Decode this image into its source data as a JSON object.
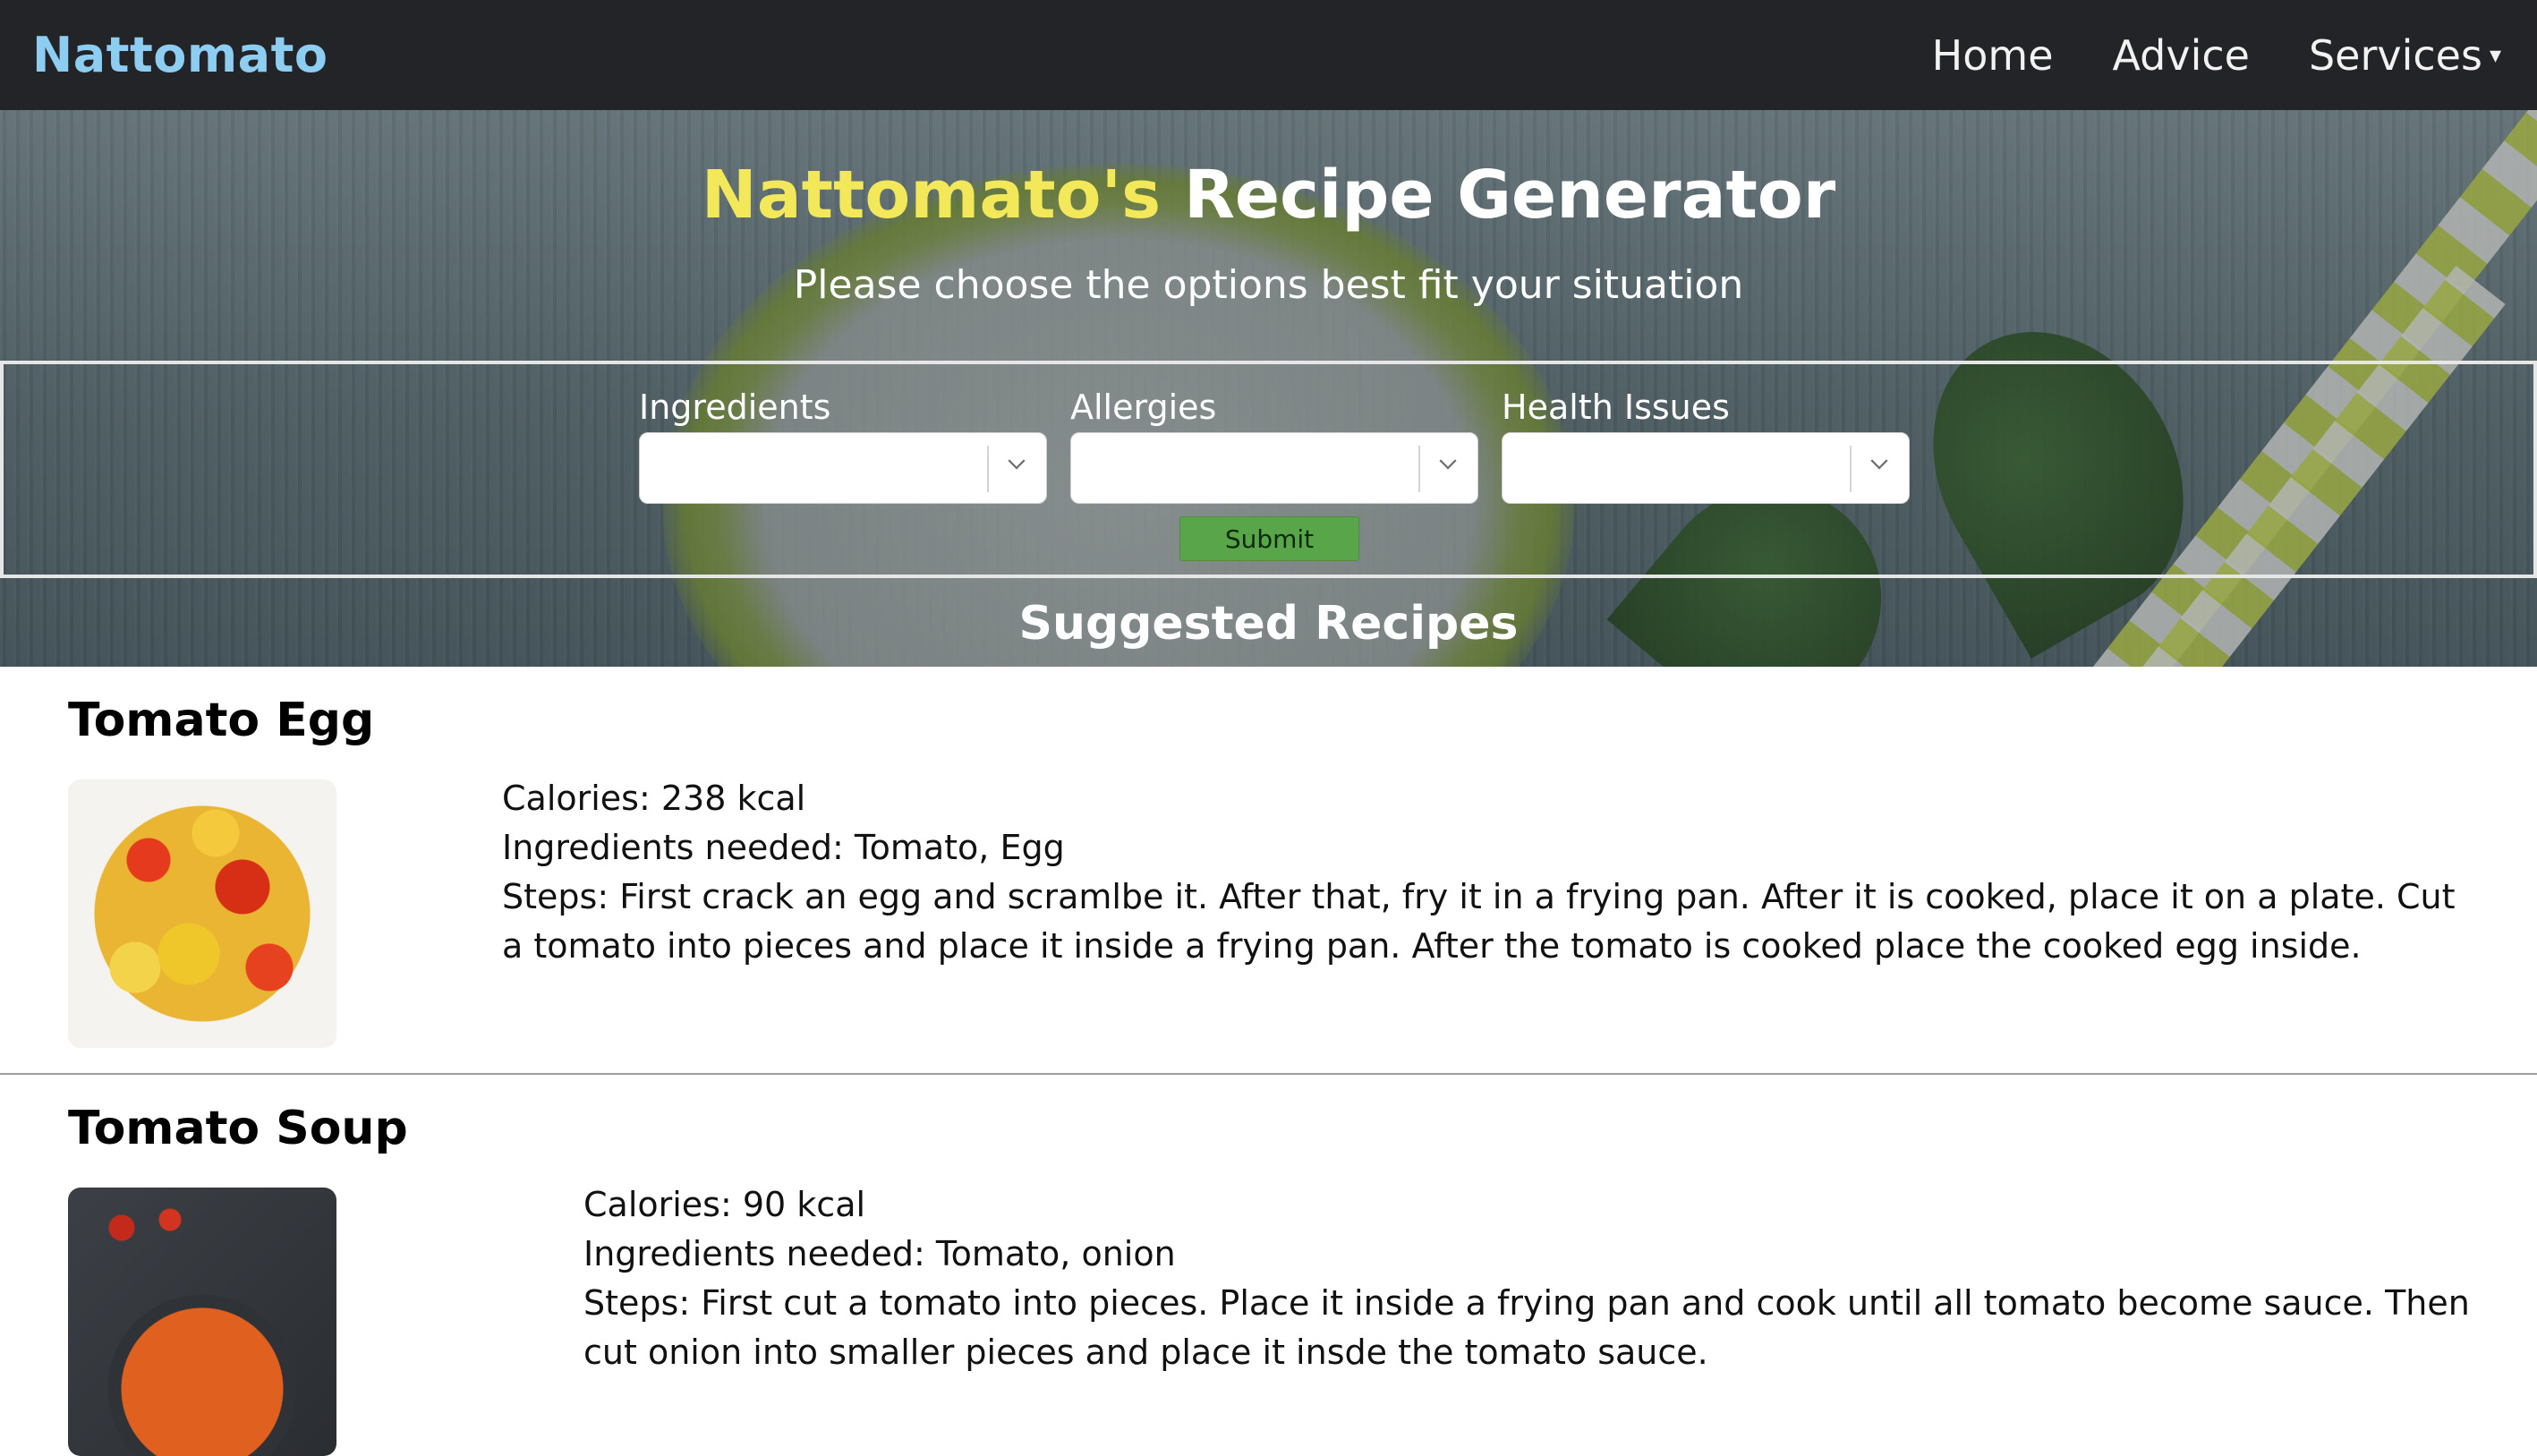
{
  "navbar": {
    "brand": "Nattomato",
    "links": [
      {
        "label": "Home"
      },
      {
        "label": "Advice"
      },
      {
        "label": "Services"
      }
    ],
    "services_caret": "▾"
  },
  "hero": {
    "title_accent": "Nattomato's",
    "title_rest": " Recipe Generator",
    "subtitle": "Please choose the options best fit your situation",
    "filters": [
      {
        "label": "Ingredients",
        "value": ""
      },
      {
        "label": "Allergies",
        "value": ""
      },
      {
        "label": "Health Issues",
        "value": ""
      }
    ],
    "submit_label": "Submit",
    "suggested_title": "Suggested Recipes"
  },
  "recipes": [
    {
      "title": "Tomato Egg",
      "calories": "Calories: 238 kcal",
      "ingredients": "Ingredients needed: Tomato, Egg",
      "steps": "Steps: First crack an egg and scramlbe it. After that, fry it in a frying pan. After it is cooked, place it on a plate. Cut a tomato into pieces and place it inside a frying pan. After the tomato is cooked place the cooked egg inside."
    },
    {
      "title": "Tomato Soup",
      "calories": "Calories: 90 kcal",
      "ingredients": "Ingredients needed: Tomato, onion",
      "steps": "Steps: First cut a tomato into pieces. Place it inside a frying pan and cook until all tomato become sauce. Then cut onion into smaller pieces and place it insde the tomato sauce."
    }
  ],
  "colors": {
    "navbar_bg": "#232428",
    "brand": "#8ecdf2",
    "title_accent": "#f2e85a",
    "submit_bg": "#58a54a"
  }
}
